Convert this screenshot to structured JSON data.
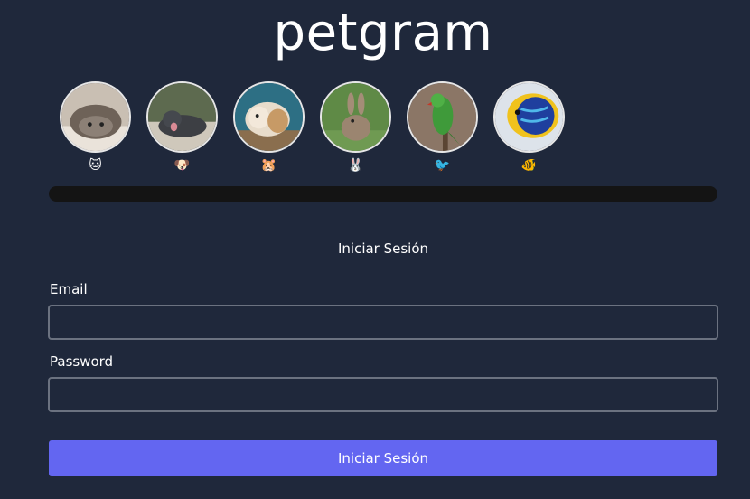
{
  "app": {
    "title": "petgram"
  },
  "categories": [
    {
      "emoji": "🐱",
      "icon": "cat-photo"
    },
    {
      "emoji": "🐶",
      "icon": "dog-photo"
    },
    {
      "emoji": "🐹",
      "icon": "hamster-photo"
    },
    {
      "emoji": "🐰",
      "icon": "rabbit-photo"
    },
    {
      "emoji": "🐦",
      "icon": "bird-photo"
    },
    {
      "emoji": "🐠",
      "icon": "fish-photo"
    }
  ],
  "form": {
    "title": "Iniciar Sesión",
    "email_label": "Email",
    "email_value": "",
    "password_label": "Password",
    "password_value": "",
    "submit_label": "Iniciar Sesión"
  },
  "colors": {
    "background": "#1f283b",
    "accent": "#6366f1",
    "input_border": "#6b7280",
    "scrollbar": "#141414"
  }
}
